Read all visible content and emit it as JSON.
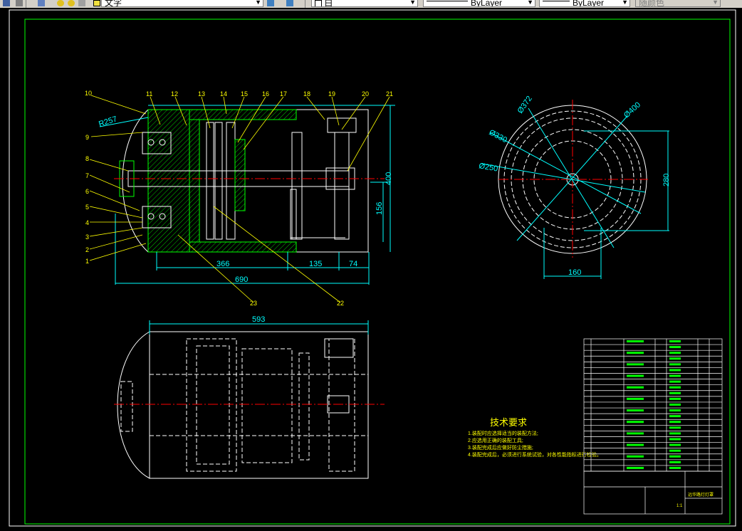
{
  "toolbar": {
    "text_style_label": "文字",
    "color_label": "白",
    "linetype_label": "ByLayer",
    "lineweight_label": "ByLayer",
    "plotstyle_label": "随颜色"
  },
  "drawing": {
    "front_view": {
      "part_numbers_left": [
        "10",
        "9",
        "8",
        "7",
        "6",
        "5",
        "4",
        "3",
        "2",
        "1"
      ],
      "part_numbers_top": [
        "11",
        "12",
        "13",
        "14",
        "15",
        "16",
        "17",
        "18",
        "19",
        "20",
        "21"
      ],
      "part_numbers_bottom": [
        "23",
        "22"
      ],
      "dims": {
        "radius": "R257",
        "height": "400",
        "shaft": "156",
        "len_a": "366",
        "len_b": "135",
        "len_c": "74",
        "total": "690"
      }
    },
    "side_view": {
      "dims": {
        "d1": "Ø372",
        "d2": "Ø400",
        "d3": "Ø330",
        "d4": "Ø250",
        "height": "280",
        "width": "160"
      }
    },
    "top_view": {
      "dims": {
        "length": "593"
      }
    },
    "tech_req": {
      "title": "技术要求",
      "lines": [
        "1.装配时应选择适当的装配方法;",
        "2.应选用正确的装配工具;",
        "3.装配完成后应做好防尘措施;",
        "4.装配完成后，必须进行系统试验，对各性能指标进行检验。"
      ]
    },
    "title_block": {
      "drawing_name": "远华路灯灯罩",
      "scale": "1:1"
    }
  }
}
